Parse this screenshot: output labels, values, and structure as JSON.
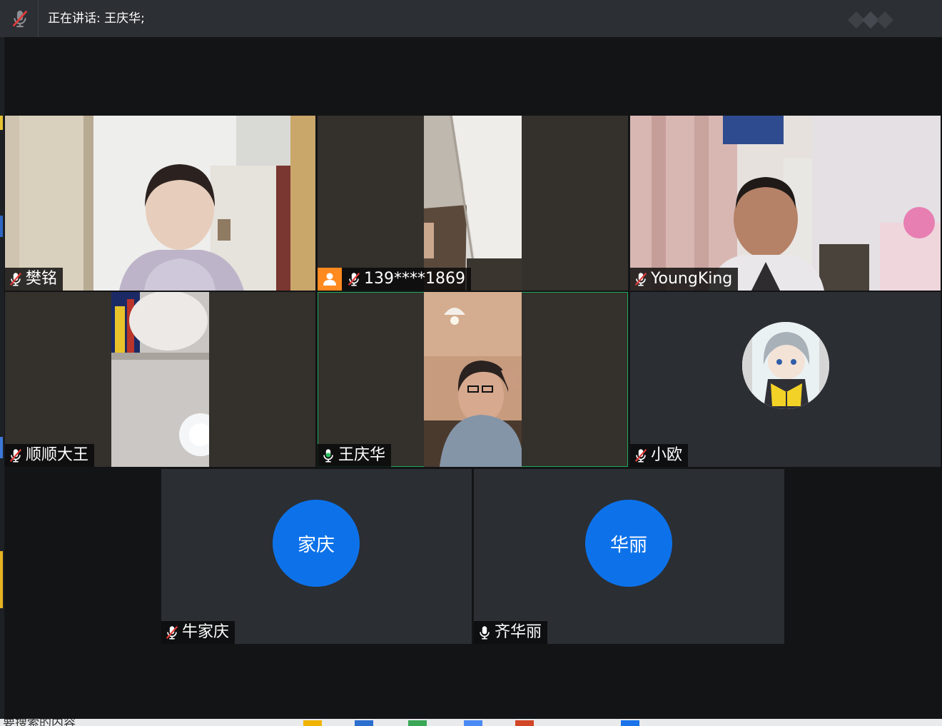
{
  "header": {
    "speaking_text": "正在讲话: 王庆华;"
  },
  "participants": [
    {
      "name": "樊铭",
      "audio": "muted",
      "video": "on"
    },
    {
      "name": "139****1869",
      "audio": "muted",
      "video": "on",
      "phone_user": true
    },
    {
      "name": "YoungKing",
      "audio": "muted",
      "video": "on"
    },
    {
      "name": "顺顺大王",
      "audio": "muted",
      "video": "on"
    },
    {
      "name": "王庆华",
      "audio": "active",
      "video": "on",
      "speaking": true
    },
    {
      "name": "小欧",
      "audio": "muted",
      "video": "off",
      "avatar": "anime-character-picture"
    },
    {
      "name": "牛家庆",
      "audio": "muted",
      "video": "off",
      "avatar_text": "家庆"
    },
    {
      "name": "齐华丽",
      "audio": "unmuted",
      "video": "off",
      "avatar_text": "华丽"
    }
  ],
  "colors": {
    "avatar_blue": "#0d72ea",
    "speaking_border": "#1faa59",
    "active_mic": "#27c25f",
    "phone_user_badge": "#ff8a1f",
    "muted_mic": "#e03a3a"
  },
  "background_fragment": "要搜索的内容"
}
